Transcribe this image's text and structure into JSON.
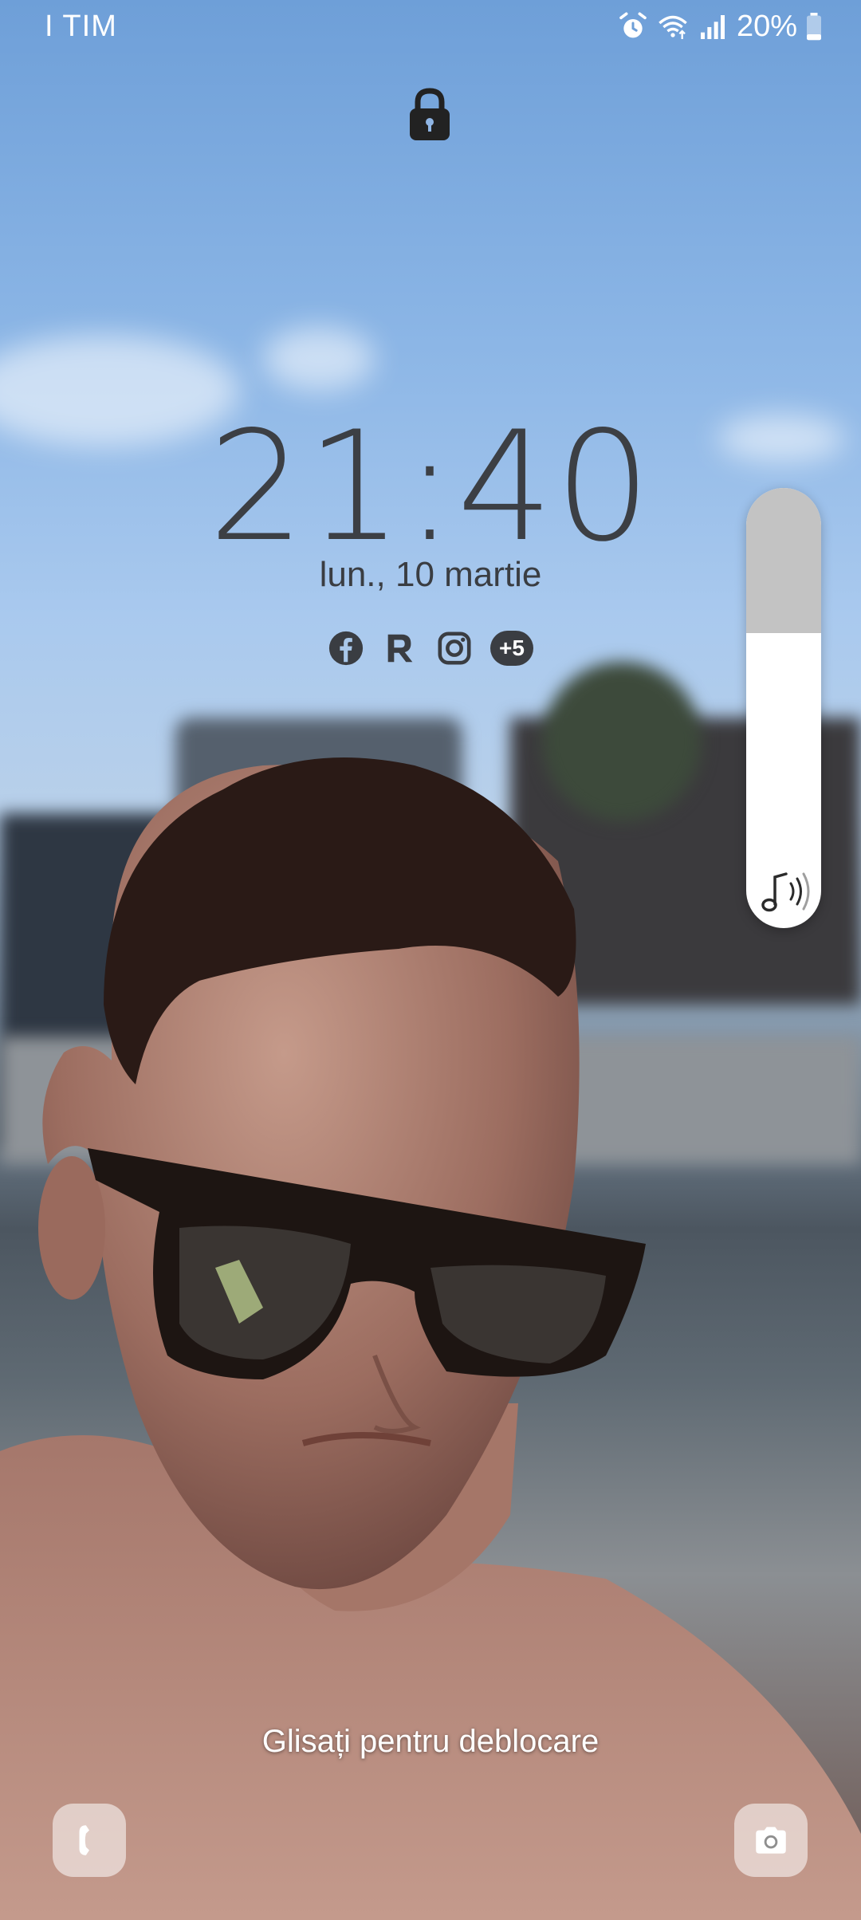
{
  "status_bar": {
    "carrier": "I TIM",
    "battery": "20%",
    "icons": [
      "alarm-icon",
      "wifi-icon",
      "signal-icon",
      "battery-icon"
    ]
  },
  "lock_screen": {
    "lock_icon": "lock-icon",
    "time": "21:40",
    "date": "lun., 10 martie",
    "notification_icons": [
      "facebook-icon",
      "r-app-icon",
      "instagram-icon"
    ],
    "more_notifications": "+5",
    "swipe_hint": "Glisați pentru deblocare"
  },
  "volume": {
    "level": 0.67,
    "icon": "music-note-volume-icon"
  },
  "shortcuts": {
    "left": "phone-icon",
    "right": "camera-icon"
  },
  "colors": {
    "clock_text": "#3c3f44",
    "volume_track": "#c3c3c3",
    "volume_fill": "#ffffff"
  }
}
